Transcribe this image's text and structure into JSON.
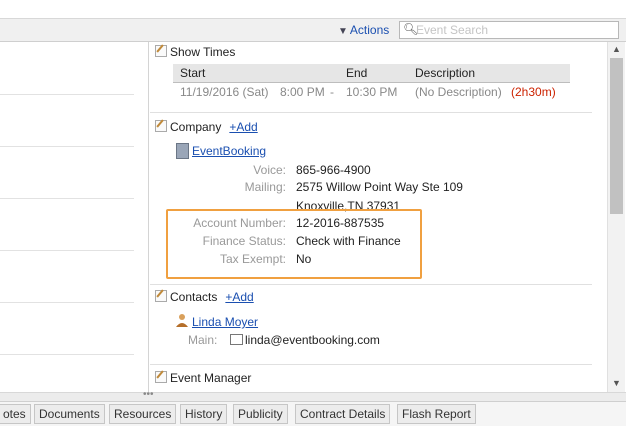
{
  "toolbar": {
    "actions_label": "Actions",
    "search_placeholder": "Event Search"
  },
  "show_times": {
    "title": "Show Times",
    "columns": [
      "Start",
      "End",
      "Description"
    ],
    "row": {
      "start_date": "11/19/2016 (Sat)",
      "start_time": "8:00 PM",
      "dash": "-",
      "end_time": "10:30 PM",
      "description": "(No Description)",
      "duration": "(2h30m)"
    }
  },
  "company": {
    "title": "Company",
    "add_label": "+Add",
    "name": "EventBooking",
    "voice_label": "Voice:",
    "voice": "865-966-4900",
    "mailing_label": "Mailing:",
    "mailing_line1": "2575 Willow Point Way Ste 109",
    "mailing_line2": "Knoxville,TN 37931",
    "account_label": "Account Number:",
    "account": "12-2016-887535",
    "finance_label": "Finance Status:",
    "finance": "Check with Finance",
    "tax_label": "Tax Exempt:",
    "tax": "No"
  },
  "contacts": {
    "title": "Contacts",
    "add_label": "+Add",
    "name": "Linda Moyer",
    "main_label": "Main:",
    "email": "linda@eventbooking.com"
  },
  "event_manager": {
    "title": "Event Manager"
  },
  "tabs": [
    "otes",
    "Documents",
    "Resources",
    "History",
    "Publicity",
    "Contract Details",
    "Flash Report"
  ],
  "colors": {
    "link": "#1a4fb0",
    "highlight": "#f0a040",
    "duration": "#cc2200"
  }
}
